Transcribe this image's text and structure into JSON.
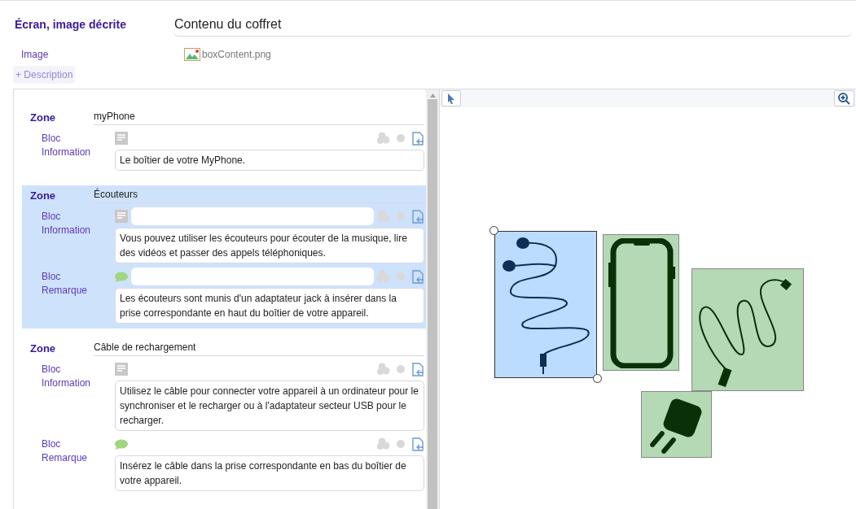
{
  "header": {
    "label": "Écran, image décrite",
    "title": "Contenu du coffret"
  },
  "image": {
    "label": "Image",
    "filename": "boxContent.png"
  },
  "add_description": "+ Description",
  "zones": [
    {
      "label": "Zone",
      "name": "myPhone",
      "selected": false,
      "blocs": [
        {
          "kind": "information",
          "label": "Bloc Information",
          "text": "Le boîtier de votre MyPhone."
        }
      ]
    },
    {
      "label": "Zone",
      "name": "Écouteurs",
      "selected": true,
      "blocs": [
        {
          "kind": "information",
          "label": "Bloc Information",
          "text": "Vous pouvez utiliser les écouteurs pour écouter de la musique, lire des vidéos et passer des appels téléphoniques."
        },
        {
          "kind": "remarque",
          "label": "Bloc Remarque",
          "text": "Les écouteurs sont munis d'un adaptateur jack à insérer dans la prise correspondante en haut du boîtier de votre appareil."
        }
      ]
    },
    {
      "label": "Zone",
      "name": "Câble de rechargement",
      "selected": false,
      "blocs": [
        {
          "kind": "information",
          "label": "Bloc Information",
          "text": "Utilisez le câble pour connecter votre appareil à un ordinateur pour le synchroniser et le recharger ou à l'adaptateur secteur USB pour le recharger."
        },
        {
          "kind": "remarque",
          "label": "Bloc Remarque",
          "text": "Insérez le câble dans la prise correspondante en bas du boîtier de votre appareil."
        }
      ]
    }
  ],
  "regions": [
    {
      "kind": "earphones",
      "selected": true
    },
    {
      "kind": "phone",
      "selected": false
    },
    {
      "kind": "cable",
      "selected": false
    },
    {
      "kind": "plug",
      "selected": false
    }
  ]
}
